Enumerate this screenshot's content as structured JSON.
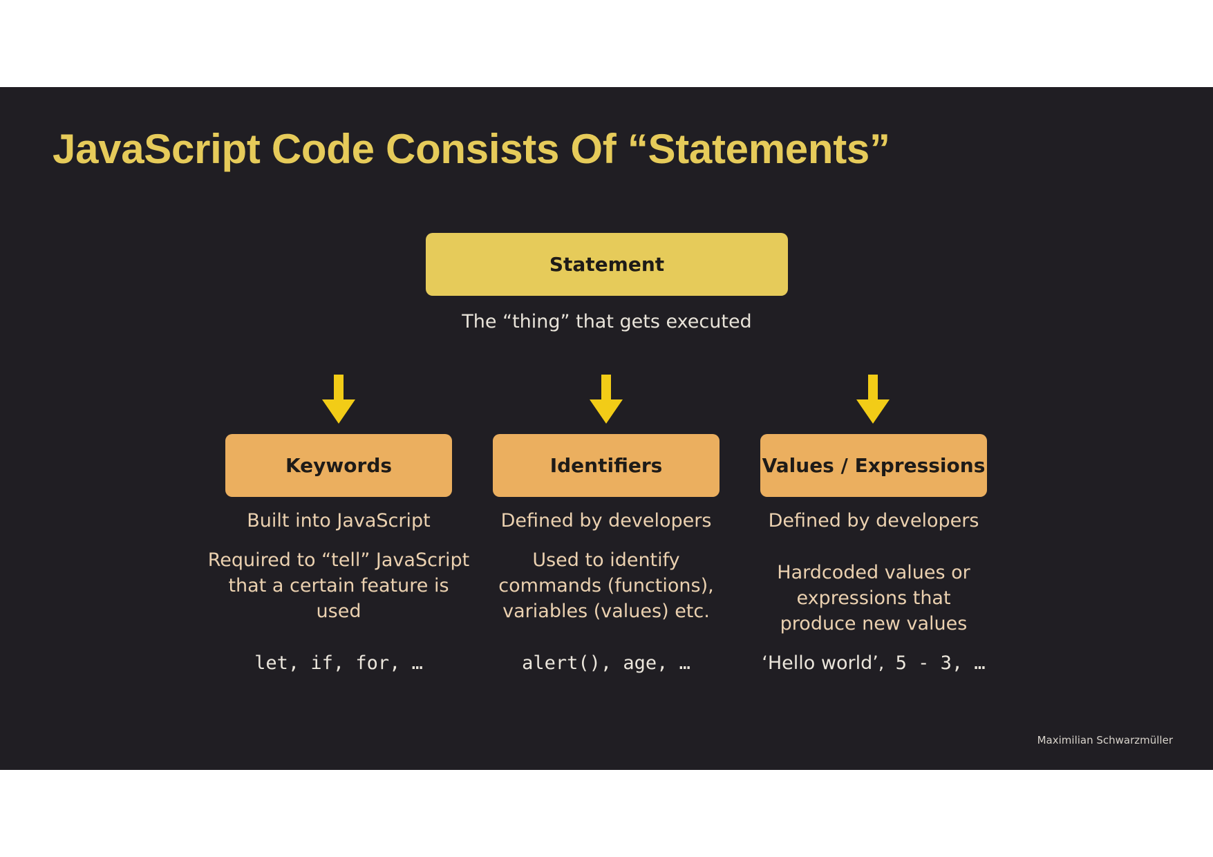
{
  "title": "JavaScript Code Consists Of “Statements”",
  "statement": {
    "label": "Statement",
    "description": "The “thing” that gets executed"
  },
  "columns": [
    {
      "label": "Keywords",
      "line1": "Built into JavaScript",
      "description": "Required to “tell” JavaScript that a certain feature is used",
      "example": "let, if, for, …"
    },
    {
      "label": "Identifiers",
      "line1": "Defined by developers",
      "description": "Used to identify commands (functions), variables (values) etc.",
      "example": "alert(), age, …"
    },
    {
      "label": "Values / Expressions",
      "line1": "Defined by developers",
      "description": "Hardcoded values or expressions that produce new values",
      "example_prefix": "‘Hello world’,",
      "example": " 5 - 3, …"
    }
  ],
  "author": "Maximilian Schwarzmüller",
  "colors": {
    "background": "#201e23",
    "title": "#e6cb5a",
    "statement_box": "#e6cb5a",
    "child_box": "#ebaf5f",
    "arrow": "#f2cc17"
  }
}
